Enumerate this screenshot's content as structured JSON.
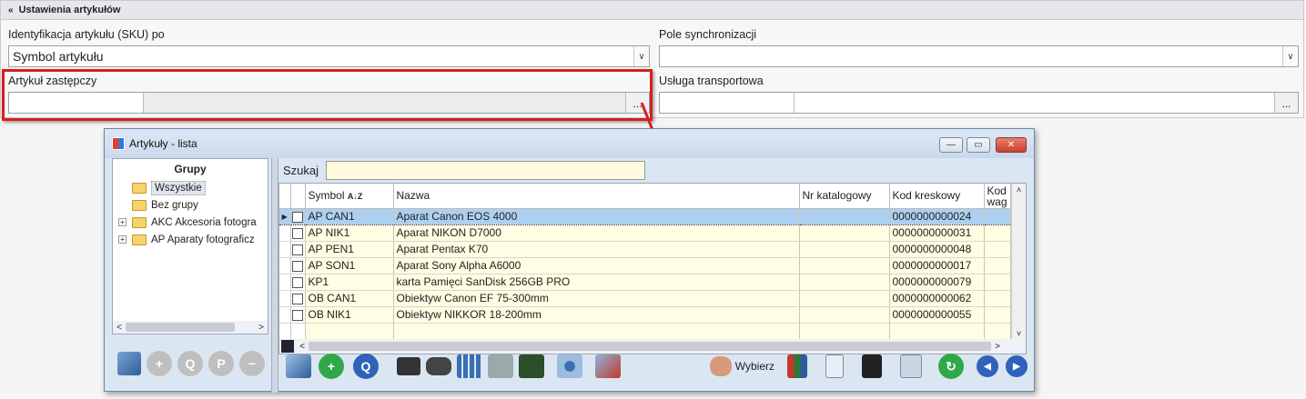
{
  "section": {
    "title": "Ustawienia artykułów"
  },
  "form": {
    "sku_label": "Identyfikacja artykułu (SKU) po",
    "sku_value": "Symbol artykułu",
    "sync_label": "Pole synchronizacji",
    "sync_value": "",
    "replacement_label": "Artykuł zastępczy",
    "transport_label": "Usługa transportowa",
    "dots": "..."
  },
  "window": {
    "title": "Artykuły - lista",
    "min": "—",
    "max": "▭",
    "close": "✕"
  },
  "groups": {
    "header": "Grupy",
    "items": [
      {
        "label": "Wszystkie",
        "expandable": false,
        "selected": true
      },
      {
        "label": "Bez grupy",
        "expandable": false,
        "selected": false
      },
      {
        "label": "AKC Akcesoria fotogra",
        "expandable": true,
        "selected": false
      },
      {
        "label": "AP  Aparaty fotograficz",
        "expandable": true,
        "selected": false
      }
    ]
  },
  "search": {
    "label": "Szukaj",
    "value": ""
  },
  "table": {
    "columns": [
      "Symbol",
      "Nazwa",
      "Nr katalogowy",
      "Kod kreskowy",
      "Kod"
    ],
    "sort_glyph": "A↓Z",
    "col5_sub": "wag",
    "rows": [
      {
        "symbol": "AP CAN1",
        "name": "Aparat Canon EOS 4000",
        "catalog": "",
        "barcode": "0000000000024"
      },
      {
        "symbol": "AP NIK1",
        "name": "Aparat NIKON D7000",
        "catalog": "",
        "barcode": "0000000000031"
      },
      {
        "symbol": "AP PEN1",
        "name": "Aparat Pentax K70",
        "catalog": "",
        "barcode": "0000000000048"
      },
      {
        "symbol": "AP SON1",
        "name": "Aparat Sony Alpha A6000",
        "catalog": "",
        "barcode": "0000000000017"
      },
      {
        "symbol": "KP1",
        "name": "karta Pamięci SanDisk 256GB PRO",
        "catalog": "",
        "barcode": "0000000000079"
      },
      {
        "symbol": "OB CAN1",
        "name": "Obiektyw Canon EF 75-300mm",
        "catalog": "",
        "barcode": "0000000000062"
      },
      {
        "symbol": "OB NIK1",
        "name": "Obiektyw NIKKOR 18-200mm",
        "catalog": "",
        "barcode": "0000000000055"
      }
    ]
  },
  "toolbar": {
    "select_label": "Wybierz"
  },
  "colors": {
    "highlight": "#d81e1e",
    "row_bg": "#fffde2",
    "selected_row": "#aed0f0"
  }
}
